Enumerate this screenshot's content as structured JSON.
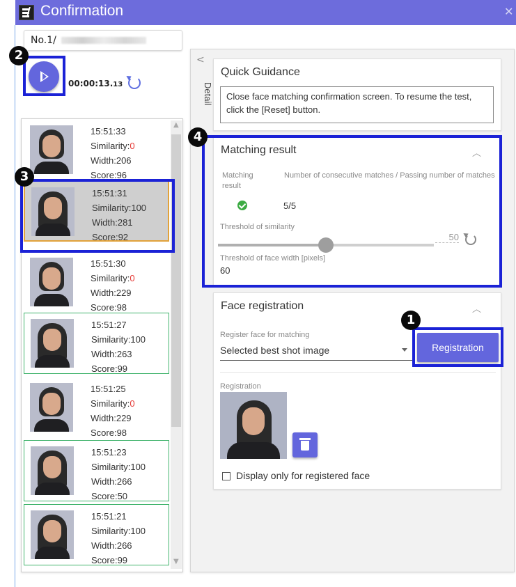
{
  "window": {
    "title": "Confirmation",
    "close_glyph": "✕",
    "icon": "app-logo-icon"
  },
  "camera": {
    "number_prefix": "No.1/"
  },
  "player": {
    "time": "00:00:13.",
    "time_fraction": "13",
    "play_icon": "play-icon",
    "reset_icon": "reset-icon"
  },
  "list": {
    "items": [
      {
        "time": "15:51:33",
        "similarity_label": "Similarity:",
        "similarity": "0",
        "width": "Width:206",
        "score": "Score:96",
        "face": "man",
        "state": "normal"
      },
      {
        "time": "15:51:31",
        "similarity_label": "Similarity:",
        "similarity": "100",
        "width": "Width:281",
        "score": "Score:92",
        "face": "woman",
        "state": "selected"
      },
      {
        "time": "15:51:30",
        "similarity_label": "Similarity:",
        "similarity": "0",
        "width": "Width:229",
        "score": "Score:98",
        "face": "man",
        "state": "normal"
      },
      {
        "time": "15:51:27",
        "similarity_label": "Similarity:",
        "similarity": "100",
        "width": "Width:263",
        "score": "Score:99",
        "face": "woman",
        "state": "match"
      },
      {
        "time": "15:51:25",
        "similarity_label": "Similarity:",
        "similarity": "0",
        "width": "Width:229",
        "score": "Score:98",
        "face": "man",
        "state": "normal"
      },
      {
        "time": "15:51:23",
        "similarity_label": "Similarity:",
        "similarity": "100",
        "width": "Width:266",
        "score": "Score:50",
        "face": "woman",
        "state": "match"
      },
      {
        "time": "15:51:21",
        "similarity_label": "Similarity:",
        "similarity": "100",
        "width": "Width:266",
        "score": "Score:99",
        "face": "woman",
        "state": "match"
      }
    ]
  },
  "detail": {
    "collapse_glyph": "<",
    "tab_label": "Detail",
    "quick_guidance": {
      "title": "Quick Guidance",
      "text": "Close face matching confirmation screen. To resume the test, click the [Reset] button."
    },
    "matching_result": {
      "title": "Matching result",
      "col1_label": "Matching result",
      "col2_label": "Number of consecutive matches / Passing number of matches",
      "status_icon": "check-circle-icon",
      "matches": "5/5",
      "similarity_threshold_label": "Threshold of similarity",
      "similarity_threshold": "50",
      "slider_level": 0.5,
      "face_width_label": "Threshold of face width [pixels]",
      "face_width": "60"
    },
    "face_registration": {
      "title": "Face registration",
      "select_label": "Register face for matching",
      "select_value": "Selected best shot image",
      "register_button": "Registration",
      "registration_label": "Registration",
      "delete_icon": "trash-icon",
      "checkbox_label": "Display only for registered face",
      "checkbox_checked": false
    }
  },
  "callouts": [
    "1",
    "2",
    "3",
    "4"
  ],
  "colors": {
    "accent": "#6366dd",
    "titlebar": "#6d6cdc",
    "highlight": "#1b22d6",
    "match_border": "#3fb36b",
    "selected_border": "#e2a23a",
    "zero_similarity": "#e53935",
    "ok_green": "#3cab43"
  }
}
